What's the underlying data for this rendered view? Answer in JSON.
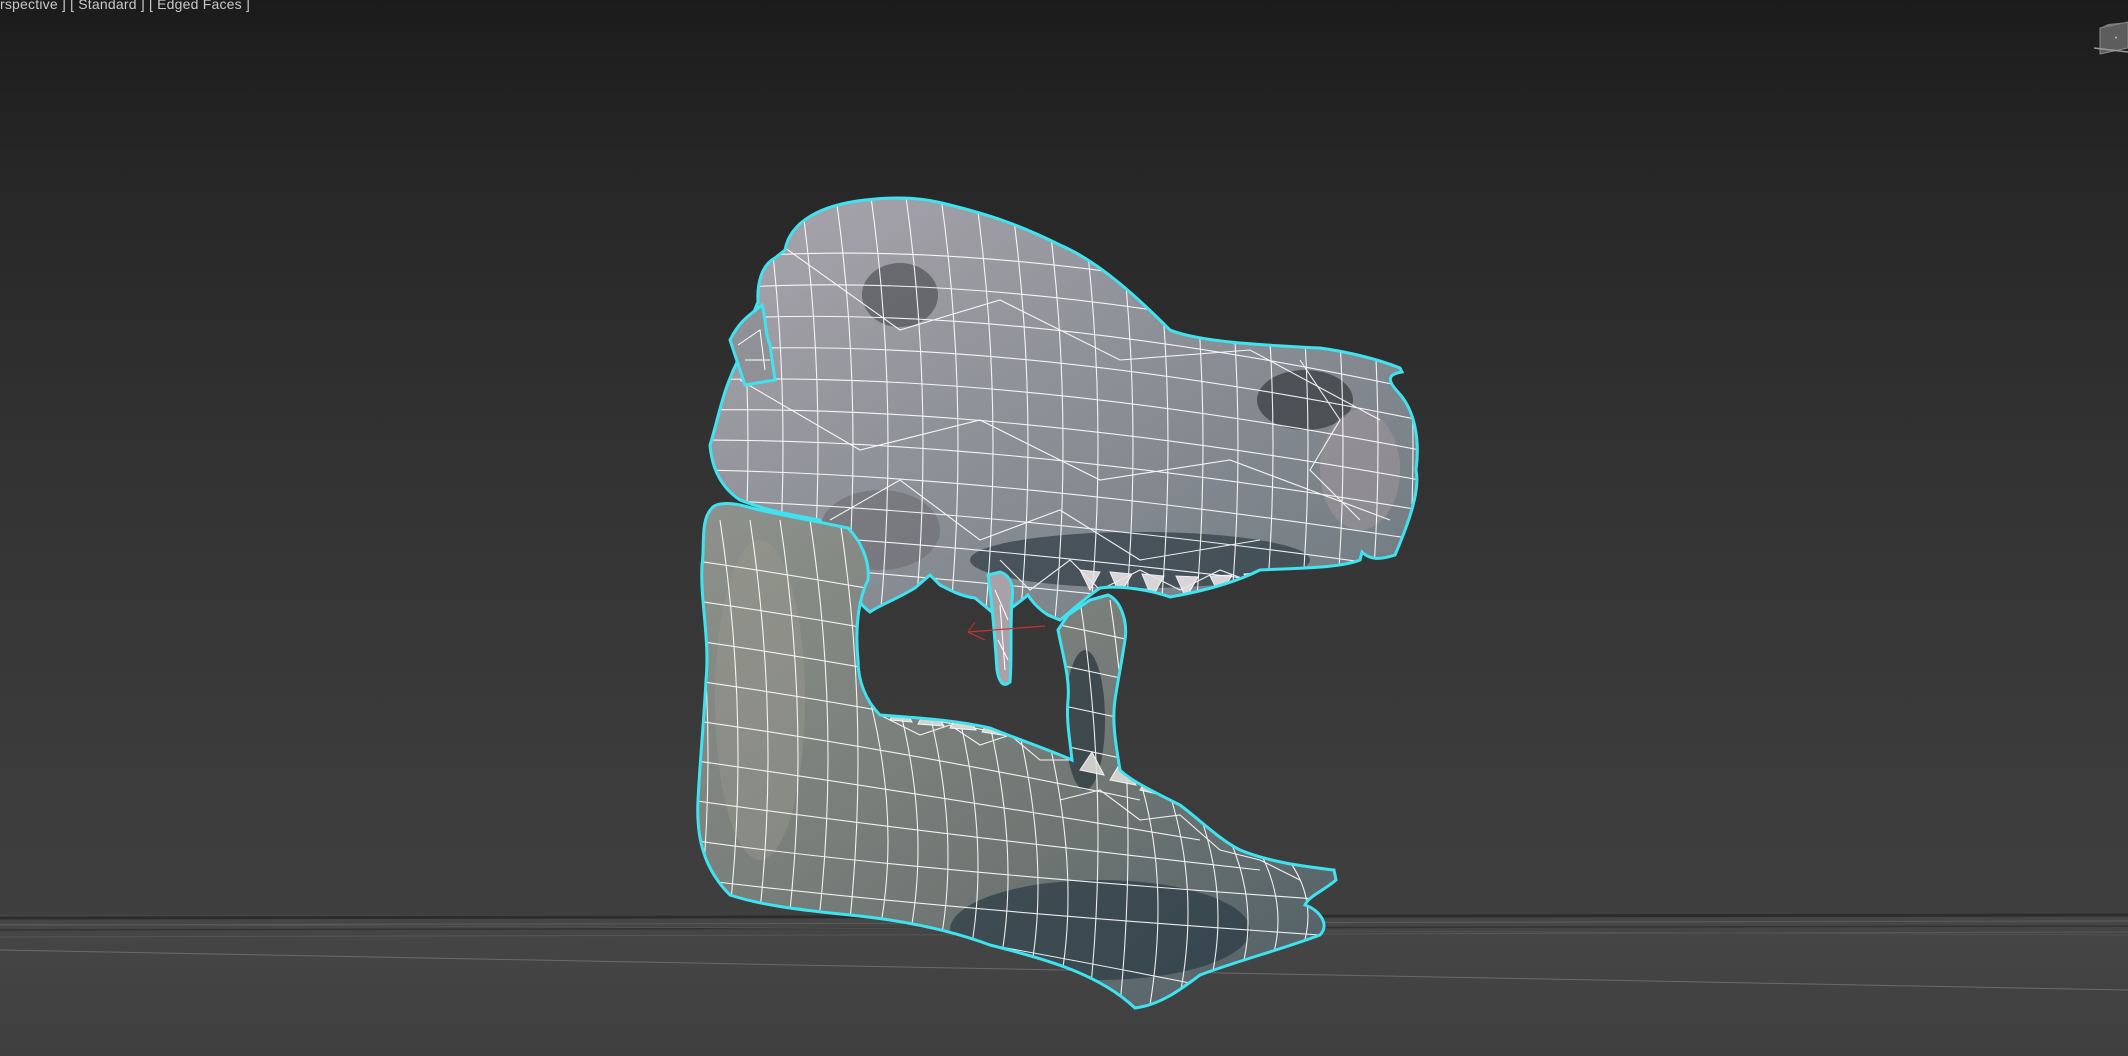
{
  "viewport": {
    "label": "[ Perspective ] [ Standard ] [ Edged Faces ]",
    "visible_label": "rspective ] [ Standard ] [ Edged Faces ]",
    "selection_color": "#3fe3ef",
    "wire_color": "#ffffff",
    "background_top": "#1b1b1b",
    "background_bottom": "#424242"
  },
  "scene": {
    "object_name": "skull model",
    "display_mode": "Edged Faces",
    "grid_visible": true
  },
  "viewcube": {
    "icon": "viewcube-icon"
  }
}
